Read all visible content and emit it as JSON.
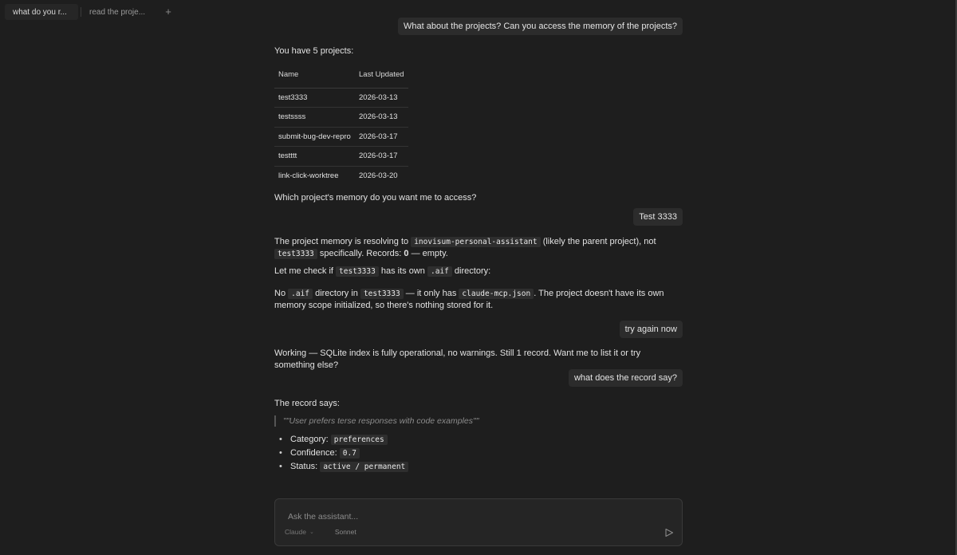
{
  "tabs": [
    {
      "label": "what do you r..."
    },
    {
      "label": "read the proje..."
    }
  ],
  "tab_add_label": "+",
  "messages": {
    "user1": "What about the projects? Can you access the memory of the projects?",
    "a1_intro": "You have 5 projects:",
    "projects_table": {
      "headers": [
        "Name",
        "Last Updated"
      ],
      "rows": [
        [
          "test3333",
          "2026-03-13"
        ],
        [
          "testssss",
          "2026-03-13"
        ],
        [
          "submit-bug-dev-repro",
          "2026-03-17"
        ],
        [
          "testttt",
          "2026-03-17"
        ],
        [
          "link-click-worktree",
          "2026-03-20"
        ]
      ]
    },
    "a1_question": "Which project's memory do you want me to access?",
    "user2": "Test 3333",
    "a2": {
      "p1_part1": "The project memory is resolving to",
      "p1_code1": "inovisum-personal-assistant",
      "p1_part2": "(likely the parent project), not",
      "p1_code2": "test3333",
      "p1_part3": "specifically. Records:",
      "p1_bold": "0",
      "p1_part4": "— empty.",
      "p2_part1": "Let me check if",
      "p2_code1": "test3333",
      "p2_part2": "has its own",
      "p2_code2": ".aif",
      "p2_part3": "directory:",
      "p3_part1": "No",
      "p3_code1": ".aif",
      "p3_part2": "directory in",
      "p3_code2": "test3333",
      "p3_part3": "— it only has",
      "p3_code3": "claude-mcp.json",
      "p3_part4": ". The project doesn't have its own memory scope initialized, so there's nothing stored for it."
    },
    "user3": "try again now",
    "a3": "Working — SQLite index is fully operational, no warnings. Still 1 record. Want me to list it or try something else?",
    "user4": "what does the record say?",
    "a4": {
      "intro": "The record says:",
      "quote": "\"\"User prefers terse responses with code examples\"\"",
      "items": [
        {
          "label": "Category:",
          "value": "preferences"
        },
        {
          "label": "Confidence:",
          "value": "0.7"
        },
        {
          "label": "Status:",
          "value": "active / permanent"
        }
      ]
    }
  },
  "composer": {
    "placeholder": "Ask the assistant...",
    "provider": "Claude",
    "model": "Sonnet"
  },
  "colors": {
    "background": "#1e1e1e",
    "user_bubble": "#2c2c2c",
    "code_bg": "#2e2e2e",
    "text": "#e2e2e2",
    "muted": "#8c8c8c"
  }
}
